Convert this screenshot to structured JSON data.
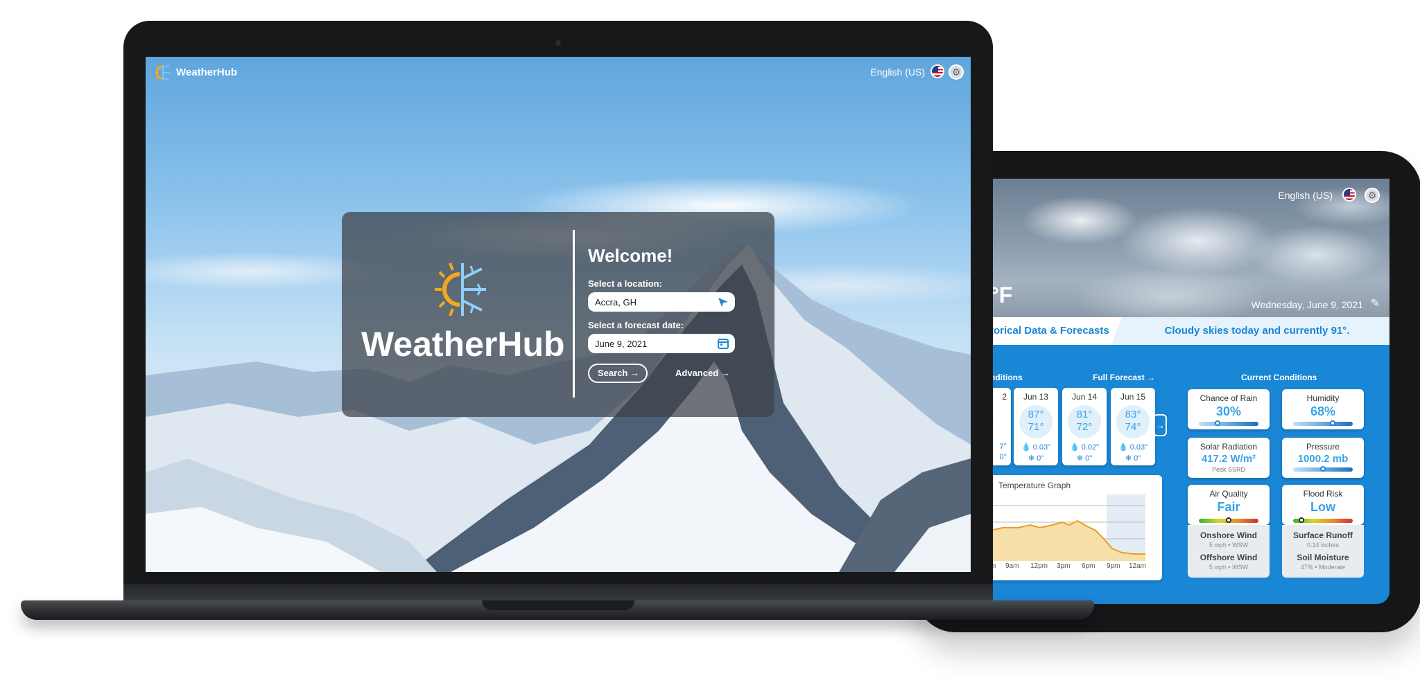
{
  "laptop": {
    "brand": "WeatherHub",
    "language": "English (US)",
    "icons": {
      "flag": "us-flag-icon",
      "settings": "gear-icon",
      "logo": "sun-snowflake-logo-icon"
    },
    "welcome": {
      "brand": "WeatherHub",
      "title": "Welcome!",
      "location_label": "Select a location:",
      "location_value": "Accra, GH",
      "date_label": "Select a forecast date:",
      "date_value": "June 9, 2021",
      "search_label": "Search",
      "advanced_label": "Advanced"
    }
  },
  "tablet": {
    "language": "English (US)",
    "temp_unit": "°F",
    "date": "Wednesday, June 9, 2021",
    "banner_left": "torical Data & Forecasts",
    "banner_right": "Cloudy skies today and currently 91°.",
    "section_left": "nditions",
    "full_forecast": "Full Forecast",
    "section_right": "Current Conditions",
    "partial_day": {
      "date": "2",
      "lo": "7°",
      "precip": "0°"
    },
    "days": [
      {
        "date": "Jun 13",
        "hi": "87°",
        "lo": "71°",
        "precip": "0.03\"",
        "snow": "0\""
      },
      {
        "date": "Jun 14",
        "hi": "81°",
        "lo": "72°",
        "precip": "0.02\"",
        "snow": "0\""
      },
      {
        "date": "Jun 15",
        "hi": "83°",
        "lo": "74°",
        "precip": "0.03\"",
        "snow": "0\""
      }
    ],
    "graph": {
      "title": "Temperature Graph",
      "ticks": [
        "m",
        "9am",
        "12pm",
        "3pm",
        "6pm",
        "9pm",
        "12am"
      ]
    },
    "conditions": {
      "rain": {
        "label": "Chance of Rain",
        "value": "30%",
        "level": 0.3
      },
      "humidity": {
        "label": "Humidity",
        "value": "68%",
        "level": 0.68
      },
      "solar": {
        "label": "Solar Radiation",
        "value": "417.2 W/m²",
        "sub": "Peak SSRD"
      },
      "pressure": {
        "label": "Pressure",
        "value": "1000.2 mb",
        "level": 0.5
      },
      "air": {
        "label": "Air Quality",
        "value": "Fair",
        "level": 0.5
      },
      "flood": {
        "label": "Flood Risk",
        "value": "Low",
        "level": 0.1
      },
      "onshore": {
        "label": "Onshore Wind",
        "value": "5 mph • WSW"
      },
      "offshore": {
        "label": "Offshore Wind",
        "value": "5 mph • WSW"
      },
      "runoff": {
        "label": "Surface Runoff",
        "value": "0.14 inches"
      },
      "soil": {
        "label": "Soil Moisture",
        "value": "47% • Moderate"
      }
    }
  }
}
